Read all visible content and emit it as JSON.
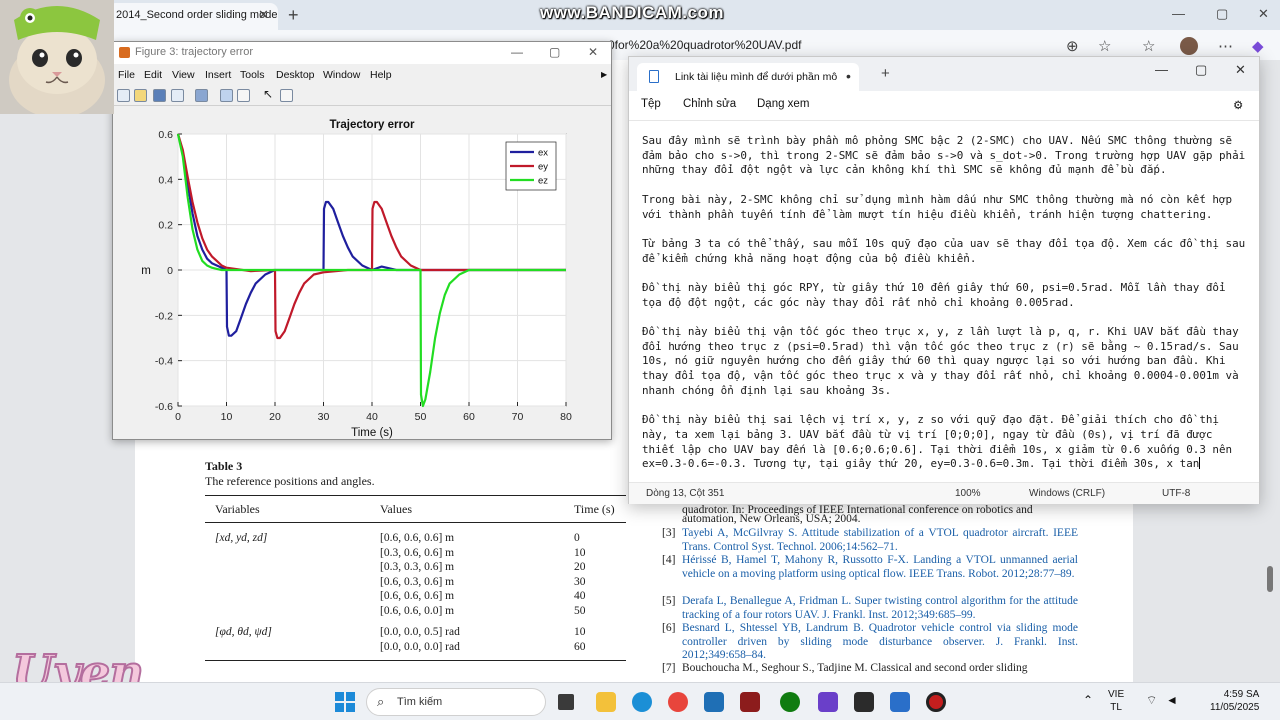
{
  "browser": {
    "tab_title": "2014_Second order sliding mode",
    "url": "0for%20a%20quadrotor%20UAV.pdf",
    "watermark": "www.BANDICAM.com"
  },
  "pdf": {
    "table_title": "Table 3",
    "table_caption": "The reference positions and angles.",
    "columns": [
      "Variables",
      "Values",
      "Time (s)"
    ],
    "position_var": "[xd, yd, zd]",
    "position_values": [
      "[0.6, 0.6, 0.6] m",
      "[0.3, 0.6, 0.6] m",
      "[0.3, 0.3, 0.6] m",
      "[0.6, 0.3, 0.6] m",
      "[0.6, 0.6, 0.6] m",
      "[0.6, 0.6, 0.0] m"
    ],
    "position_times": [
      "0",
      "10",
      "20",
      "30",
      "40",
      "50"
    ],
    "angle_var": "[φd, θd, ψd]",
    "angle_values": [
      "[0.0, 0.0, 0.5] rad",
      "[0.0, 0.0, 0.0] rad"
    ],
    "angle_times": [
      "10",
      "60"
    ],
    "ref_partial_1": "quadrotor. In: Proceedings of IEEE International conference on robotics and",
    "ref_partial_2": "automation, New Orleans, USA; 2004.",
    "references": [
      {
        "num": "[3]",
        "text": "Tayebi A, McGilvray S. Attitude stabilization of a VTOL quadrotor aircraft. IEEE Trans. Control Syst. Technol. 2006;14:562–71."
      },
      {
        "num": "[4]",
        "text": "Hérissé B, Hamel T, Mahony R, Russotto F-X. Landing a VTOL unmanned aerial vehicle on a moving platform using optical flow. IEEE Trans. Robot. 2012;28:77–89."
      },
      {
        "num": "[5]",
        "text": "Derafa L, Benallegue A, Fridman L. Super twisting control algorithm for the attitude tracking of a four rotors UAV. J. Frankl. Inst. 2012;349:685–99."
      },
      {
        "num": "[6]",
        "text": "Besnard L, Shtessel YB, Landrum B. Quadrotor vehicle control via sliding mode controller driven by sliding mode disturbance observer. J. Frankl. Inst. 2012;349:658–84."
      },
      {
        "num": "[7]",
        "text": "Bouchoucha M., Seghour S., Tadjine M. Classical and second order sliding"
      }
    ]
  },
  "figure": {
    "window_title": "Figure 3: trajectory error",
    "menu": [
      "File",
      "Edit",
      "View",
      "Insert",
      "Tools",
      "Desktop",
      "Window",
      "Help"
    ]
  },
  "chart_data": {
    "type": "line",
    "title": "Trajectory error",
    "xlabel": "Time (s)",
    "ylabel": "m",
    "xlim": [
      0,
      80
    ],
    "ylim": [
      -0.6,
      0.6
    ],
    "xticks": [
      "0",
      "10",
      "20",
      "30",
      "40",
      "50",
      "60",
      "70",
      "80"
    ],
    "yticks": [
      "0.6",
      "0.4",
      "0.2",
      "0",
      "-0.2",
      "-0.4",
      "-0.6"
    ],
    "grid": true,
    "legend_position": "top-right",
    "series": [
      {
        "name": "ex",
        "color": "#1f1f9e",
        "x": [
          0,
          1,
          2,
          3,
          4,
          5,
          6,
          7,
          8,
          9,
          10,
          10.1,
          10.5,
          11,
          12,
          13,
          14,
          15,
          16,
          18,
          20,
          25,
          30,
          30.1,
          30.5,
          31,
          32,
          33,
          34,
          35,
          36,
          38,
          40,
          42,
          45,
          50,
          60,
          80
        ],
        "y": [
          0.6,
          0.52,
          0.38,
          0.25,
          0.15,
          0.09,
          0.05,
          0.03,
          0.02,
          0.01,
          0.0,
          -0.25,
          -0.29,
          -0.29,
          -0.27,
          -0.21,
          -0.15,
          -0.1,
          -0.06,
          -0.02,
          0.0,
          0.0,
          0.0,
          0.27,
          0.3,
          0.3,
          0.27,
          0.21,
          0.15,
          0.1,
          0.06,
          0.02,
          0.0,
          0.015,
          0.0,
          0.0,
          0.0,
          0.0
        ]
      },
      {
        "name": "ey",
        "color": "#c0192a",
        "x": [
          0,
          1,
          2,
          3,
          4,
          5,
          6,
          7,
          8,
          9,
          10,
          15,
          20,
          20.1,
          20.5,
          21,
          22,
          23,
          24,
          25,
          26,
          28,
          30,
          35,
          40,
          40.1,
          40.5,
          41,
          42,
          43,
          44,
          45,
          46,
          48,
          50,
          55,
          60,
          80
        ],
        "y": [
          0.6,
          0.53,
          0.41,
          0.3,
          0.21,
          0.14,
          0.09,
          0.06,
          0.04,
          0.02,
          0.01,
          -0.005,
          0.0,
          -0.27,
          -0.3,
          -0.3,
          -0.27,
          -0.21,
          -0.15,
          -0.1,
          -0.06,
          -0.02,
          -0.01,
          0.0,
          0.0,
          0.27,
          0.3,
          0.3,
          0.27,
          0.21,
          0.15,
          0.1,
          0.06,
          0.02,
          0.0,
          0.0,
          0.0,
          0.0
        ]
      },
      {
        "name": "ez",
        "color": "#22dd22",
        "x": [
          0,
          1,
          2,
          3,
          4,
          5,
          6,
          7,
          8,
          9,
          10,
          20,
          30,
          40,
          50,
          50.1,
          50.5,
          51,
          52,
          53,
          54,
          55,
          56,
          58,
          60,
          65,
          80
        ],
        "y": [
          0.6,
          0.5,
          0.32,
          0.18,
          0.09,
          0.04,
          0.02,
          0.01,
          0.005,
          0.0,
          0.0,
          0.0,
          0.0,
          0.0,
          0.0,
          -0.55,
          -0.6,
          -0.57,
          -0.45,
          -0.3,
          -0.19,
          -0.11,
          -0.06,
          -0.02,
          0.0,
          0.0,
          0.0
        ]
      }
    ]
  },
  "notepad": {
    "tab_title": "Link tài liệu mình để dưới phần mô",
    "menu": [
      "Tệp",
      "Chỉnh sửa",
      "Dạng xem"
    ],
    "paragraphs": [
      "Sau đây mình sẽ trình bày phần mô phỏng SMC bậc 2 (2-SMC) cho UAV. Nếu SMC thông thường sẽ đảm bảo cho s->0, thì trong 2-SMC sẽ đảm bảo s->0 và s_dot->0. Trong trường hợp UAV gặp phải những thay đổi đột ngột và lực cản không khí thì SMC sẽ không đủ mạnh để bù đắp.",
      "Trong bài này, 2-SMC không chỉ sử dụng mình hàm dấu như SMC thông thường mà nó còn kết hợp với thành phần tuyến tính để làm mượt tín hiệu điều khiển, tránh hiện tượng chattering.",
      "Từ bảng 3 ta có thể thấy, sau mỗi 10s quỹ đạo của uav sẽ thay đổi tọa độ. Xem các đồ thị sau để kiểm chứng khả năng hoạt động của bộ điều khiển.",
      "Đồ thị này biểu thị góc RPY, từ giây thứ 10 đến giây thứ 60, psi=0.5rad. Mỗi lần thay đổi tọa độ đột ngột, các góc này thay đổi rất nhỏ chỉ khoảng 0.005rad.",
      "Đồ thị này biểu thị vận tốc góc theo trục x, y, z lần lượt là p, q, r. Khi UAV bắt đầu thay đổi hướng theo trục z (psi=0.5rad) thì vận tốc góc theo trục z (r) sẽ bằng ~ 0.15rad/s. Sau 10s, nó giữ nguyên hướng cho đến giây thứ 60 thì quay ngược lại so với hướng ban đầu. Khi thay đổi tọa độ, vận tốc góc theo trục x và y thay đổi rất nhỏ, chỉ khoảng 0.0004-0.001m và nhanh chóng ổn định lại sau khoảng 3s.",
      "Đồ thị này biểu thị sai lệch vị trí x, y, z so với quỹ đạo đặt. Để giải thích cho đồ thị này, ta xem lại bảng 3. UAV bắt đầu từ vị trí [0;0;0], ngay từ đầu (0s), vị trí đã được thiết lập cho UAV bay đến là [0.6;0.6;0.6]. Tại thời điểm 10s, x giảm từ 0.6 xuống 0.3 nên ex=0.3-0.6=-0.3. Tương tự, tại giây thứ 20, ey=0.3-0.6=0.3m. Tại thời điểm 30s, x tan"
    ],
    "status_position": "Dòng 13, Cột 351",
    "status_zoom": "100%",
    "status_eol": "Windows (CRLF)",
    "status_encoding": "UTF-8"
  },
  "overlay_text": "Uyen",
  "taskbar": {
    "search_placeholder": "Tìm kiếm",
    "lang_line1": "VIE",
    "lang_line2": "TL",
    "time": "4:59 SA",
    "date": "11/05/2025"
  }
}
